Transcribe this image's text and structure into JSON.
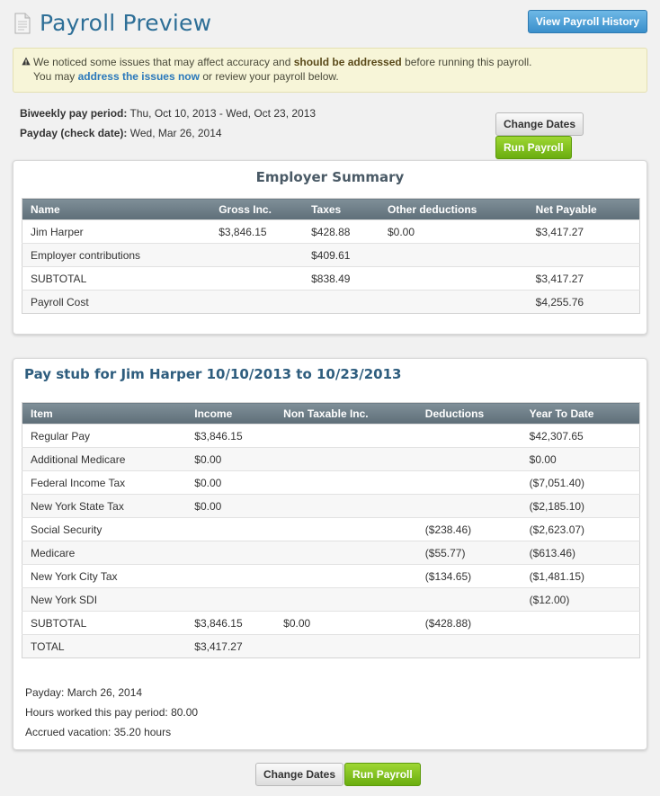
{
  "header": {
    "title": "Payroll Preview",
    "history_button": "View Payroll History"
  },
  "alert": {
    "line1_pre": "We noticed some issues that may affect accuracy and ",
    "line1_bold": "should be addressed",
    "line1_post": " before running this payroll.",
    "line2_pre": "You may ",
    "line2_link": "address the issues now",
    "line2_post": " or review your payroll below."
  },
  "period": {
    "pay_period_label": "Biweekly pay period:",
    "pay_period_value": "Thu, Oct 10, 2013 - Wed, Oct 23, 2013",
    "payday_label": "Payday (check date):",
    "payday_value": "Wed, Mar 26, 2014"
  },
  "actions": {
    "change_dates": "Change Dates",
    "run_payroll": "Run Payroll"
  },
  "employer_summary": {
    "title": "Employer Summary",
    "columns": [
      "Name",
      "Gross Inc.",
      "Taxes",
      "Other deductions",
      "Net Payable"
    ],
    "rows": [
      [
        "Jim Harper",
        "$3,846.15",
        "$428.88",
        "$0.00",
        "$3,417.27"
      ],
      [
        "Employer contributions",
        "",
        "$409.61",
        "",
        ""
      ],
      [
        "SUBTOTAL",
        "",
        "$838.49",
        "",
        "$3,417.27"
      ],
      [
        "Payroll Cost",
        "",
        "",
        "",
        "$4,255.76"
      ]
    ]
  },
  "pay_stub": {
    "title": "Pay stub for Jim Harper 10/10/2013 to 10/23/2013",
    "columns": [
      "Item",
      "Income",
      "Non Taxable Inc.",
      "Deductions",
      "Year To Date"
    ],
    "rows": [
      [
        "Regular Pay",
        "$3,846.15",
        "",
        "",
        "$42,307.65"
      ],
      [
        "Additional Medicare",
        "$0.00",
        "",
        "",
        "$0.00"
      ],
      [
        "Federal Income Tax",
        "$0.00",
        "",
        "",
        "($7,051.40)"
      ],
      [
        "New York State Tax",
        "$0.00",
        "",
        "",
        "($2,185.10)"
      ],
      [
        "Social Security",
        "",
        "",
        "($238.46)",
        "($2,623.07)"
      ],
      [
        "Medicare",
        "",
        "",
        "($55.77)",
        "($613.46)"
      ],
      [
        "New York City Tax",
        "",
        "",
        "($134.65)",
        "($1,481.15)"
      ],
      [
        "New York SDI",
        "",
        "",
        "",
        "($12.00)"
      ],
      [
        "SUBTOTAL",
        "$3,846.15",
        "$0.00",
        "($428.88)",
        ""
      ],
      [
        "TOTAL",
        "$3,417.27",
        "",
        "",
        ""
      ]
    ],
    "notes": [
      "Payday: March 26, 2014",
      "Hours worked this pay period: 80.00",
      "Accrued vacation: 35.20 hours"
    ]
  },
  "icons": {
    "title_icon": "document-icon",
    "alert_icon": "warning-icon"
  },
  "colors": {
    "title": "#2e6f97",
    "blue_button": "#3a8fcb",
    "green_button": "#6aad0f",
    "table_header": "#6a7a84",
    "alert_bg": "#f7f5d8"
  }
}
